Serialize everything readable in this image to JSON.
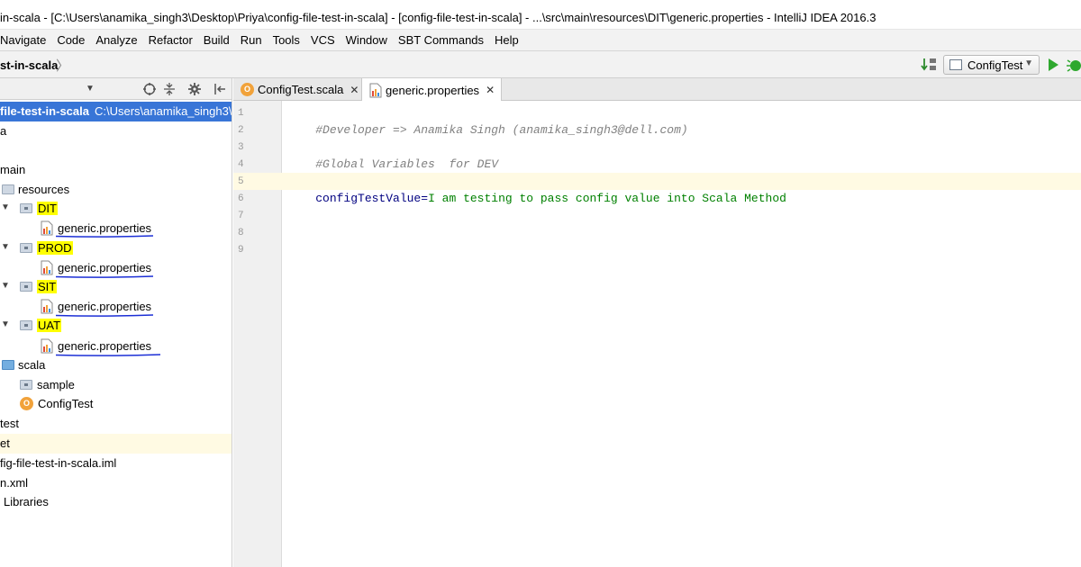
{
  "window": {
    "title": "in-scala - [C:\\Users\\anamika_singh3\\Desktop\\Priya\\config-file-test-in-scala] - [config-file-test-in-scala] - ...\\src\\main\\resources\\DIT\\generic.properties - IntelliJ IDEA 2016.3"
  },
  "menu": [
    "Navigate",
    "Code",
    "Analyze",
    "Refactor",
    "Build",
    "Run",
    "Tools",
    "VCS",
    "Window",
    "SBT Commands",
    "Help"
  ],
  "navbar": {
    "breadcrumb": "st-in-scala",
    "run_config": "ConfigTest"
  },
  "editor_tabs": [
    {
      "label": "ConfigTest.scala",
      "active": false
    },
    {
      "label": "generic.properties",
      "active": true
    }
  ],
  "tree": {
    "root_label": "file-test-in-scala",
    "root_path": "C:\\Users\\anamika_singh3\\D",
    "items": [
      "a",
      "main",
      "resources",
      "DIT",
      "generic.properties",
      "PROD",
      "generic.properties",
      "SIT",
      "generic.properties",
      "UAT",
      "generic.properties",
      "scala",
      "sample",
      "ConfigTest",
      "test",
      "et",
      "fig-file-test-in-scala.iml",
      "n.xml",
      "Libraries"
    ]
  },
  "code": {
    "line_numbers": [
      "1",
      "2",
      "3",
      "4",
      "5",
      "6",
      "7",
      "8",
      "9"
    ],
    "line1": "#Developer => Anamika Singh (anamika_singh3@dell.com)",
    "line3": "#Global Variables  for DEV",
    "line5_key": "configTestValue",
    "line5_sep": "=",
    "line5_value": "I am testing to pass config value into Scala Method"
  },
  "colors": {
    "selection": "#3875d7",
    "highlight": "#ffff00",
    "current_line": "#fffae3",
    "annotation_underline": "#1c2fd6"
  }
}
